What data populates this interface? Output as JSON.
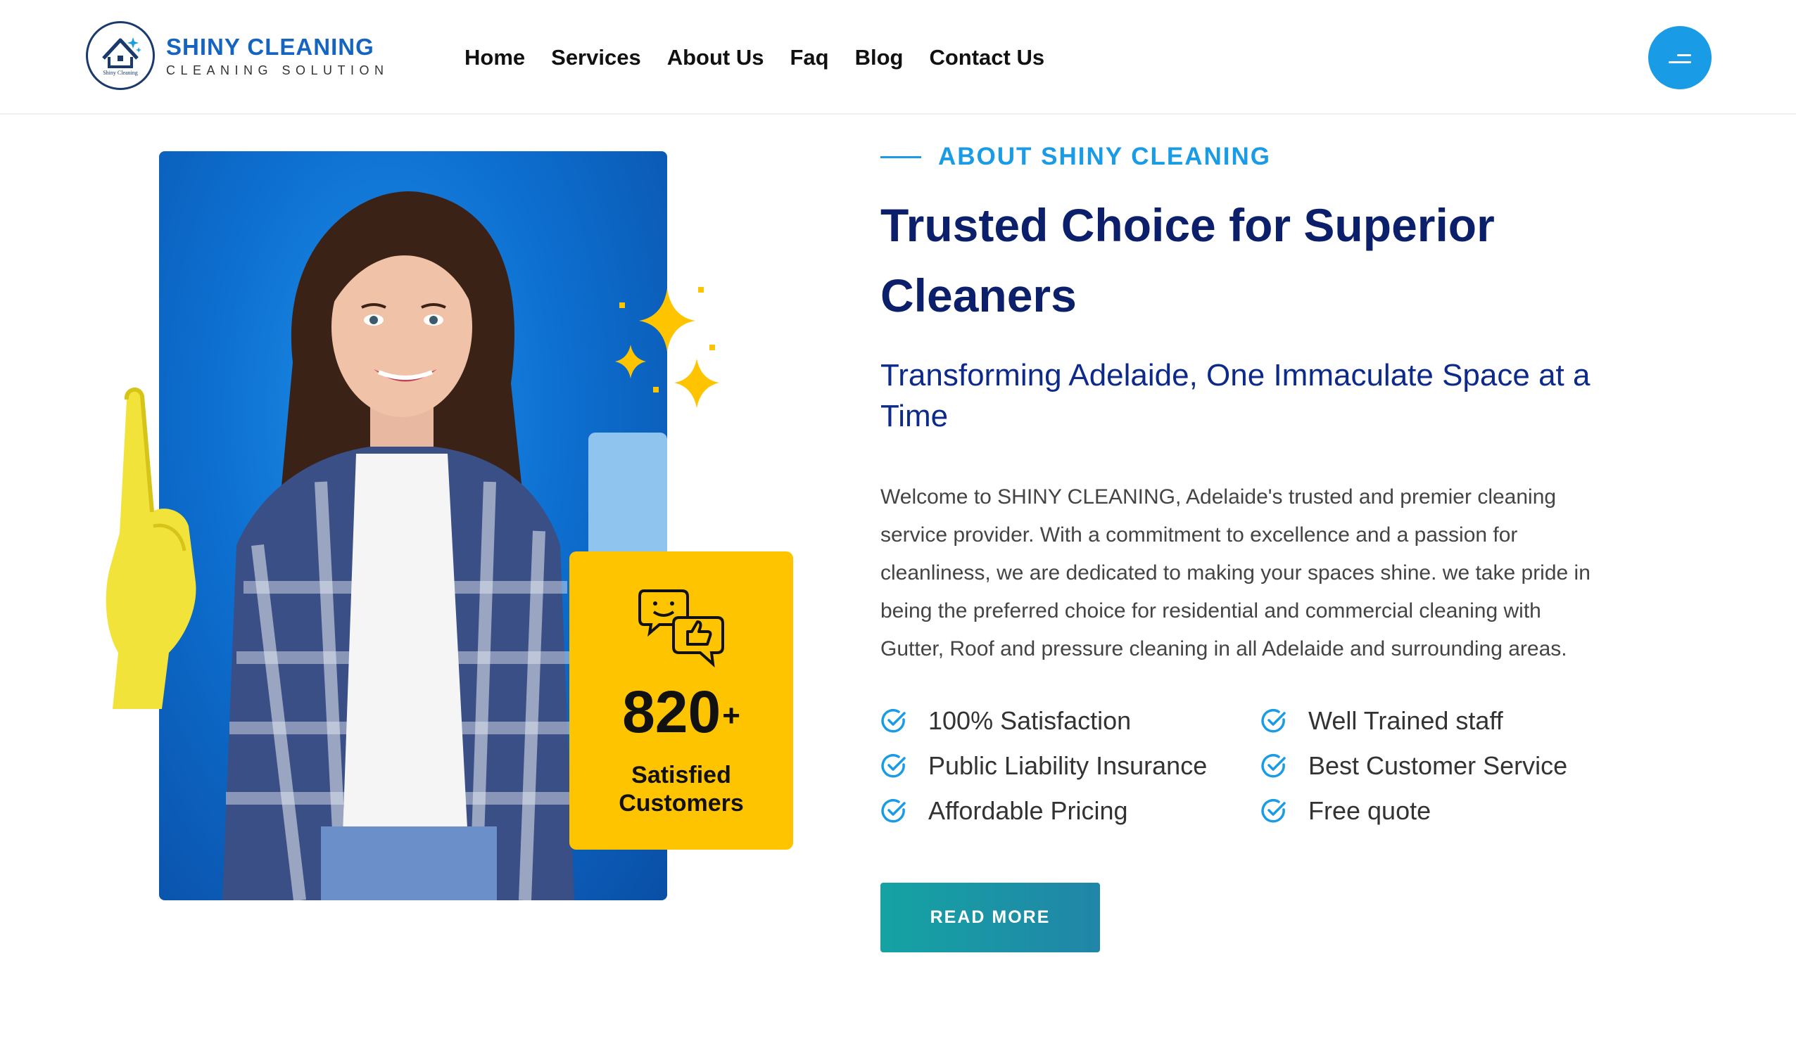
{
  "brand": {
    "name": "SHINY CLEANING",
    "tagline": "CLEANING SOLUTION",
    "badge_text": "Shiny Cleaning",
    "primary_color": "#1a9be6",
    "title_color": "#0b1f6b"
  },
  "nav": {
    "items": [
      {
        "label": "Home"
      },
      {
        "label": "Services"
      },
      {
        "label": "About Us"
      },
      {
        "label": "Faq"
      },
      {
        "label": "Blog"
      },
      {
        "label": "Contact Us"
      }
    ],
    "menu_icon": "hamburger-icon"
  },
  "stat": {
    "number": "820",
    "suffix": "+",
    "label_line1": "Satisfied",
    "label_line2": "Customers",
    "icon": "chat-thumbs-up-icon",
    "card_color": "#ffc400"
  },
  "about": {
    "eyebrow": "ABOUT SHINY CLEANING",
    "title_line1": "Trusted Choice for Superior",
    "title_line2": "Cleaners",
    "subtitle": "Transforming Adelaide, One Immaculate Space at a Time",
    "body_lines": [
      "Welcome to SHINY CLEANING, Adelaide's trusted and premier cleaning",
      "service provider. With a commitment to excellence and a passion for",
      "cleanliness, we are dedicated to making your spaces shine. we take pride in",
      "being the preferred choice for residential and commercial cleaning with",
      "Gutter, Roof and pressure cleaning in all Adelaide and surrounding areas."
    ]
  },
  "features": {
    "left": [
      "100% Satisfaction",
      "Public Liability Insurance",
      "Affordable Pricing"
    ],
    "right": [
      "Well Trained staff",
      "Best Customer Service",
      "Free quote"
    ]
  },
  "cta": {
    "label": "READ MORE"
  }
}
